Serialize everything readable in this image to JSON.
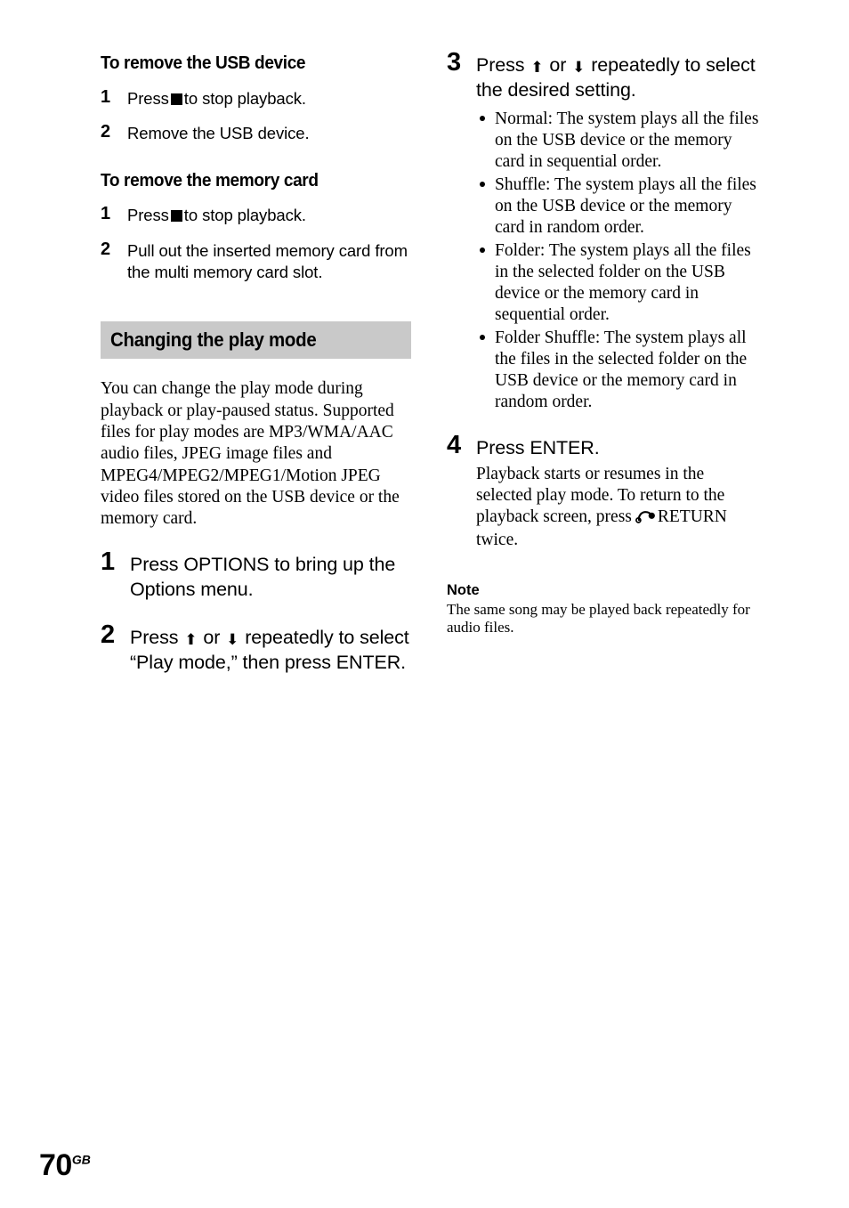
{
  "page": {
    "number": "70",
    "region_suffix": "GB"
  },
  "left_column": {
    "section_usb": {
      "heading": "To remove the USB device",
      "steps": [
        {
          "num": "1",
          "before": "Press",
          "icon": "stop-square-icon",
          "after": "to stop playback."
        },
        {
          "num": "2",
          "text": "Remove the USB device."
        }
      ]
    },
    "section_memory_card": {
      "heading": "To remove the memory card",
      "steps": [
        {
          "num": "1",
          "before": "Press",
          "icon": "stop-square-icon",
          "after": "to stop playback."
        },
        {
          "num": "2",
          "text": "Pull out the inserted memory card from the multi memory card slot."
        }
      ]
    },
    "section_play_mode": {
      "heading": "Changing the play mode",
      "intro": "You can change the play mode during playback or play-paused status. Supported files for play modes are MP3/WMA/AAC audio files, JPEG image files and MPEG4/MPEG2/MPEG1/Motion JPEG video files stored on the USB device or the memory card.",
      "step1": {
        "num": "1",
        "text": "Press OPTIONS to bring up the Options menu."
      },
      "step2": {
        "num": "2",
        "part1": "Press",
        "arrow_up": "⬆",
        "or": "or",
        "arrow_down": "⬇",
        "part2": "repeatedly to select “Play mode,” then press ENTER."
      }
    }
  },
  "right_column": {
    "step3": {
      "num": "3",
      "part1": "Press",
      "arrow_up": "⬆",
      "or": "or",
      "arrow_down": "⬇",
      "part2": "repeatedly to select the desired setting.",
      "bullets": [
        "Normal: The system plays all the files on the USB device or the memory card in sequential order.",
        "Shuffle: The system plays all the files on the USB device or the memory card in random order.",
        "Folder: The system plays all the files in the selected folder on the USB device or the memory card in sequential order.",
        "Folder Shuffle: The system plays all the files in the selected folder on the USB device or the memory card in random order."
      ]
    },
    "step4": {
      "num": "4",
      "title": "Press ENTER.",
      "body_before": "Playback starts or resumes in the selected play mode. To return to the playback screen, press",
      "return_icon": "return-arrow-icon",
      "body_after": "RETURN twice."
    },
    "note": {
      "heading": "Note",
      "body": "The same song may be played back repeatedly for audio files."
    }
  }
}
